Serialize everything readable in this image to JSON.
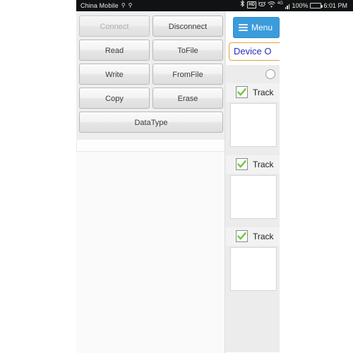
{
  "status_bar": {
    "carrier": "China Mobile",
    "sim_glyph_1": "⚲",
    "sim_glyph_2": "⚲",
    "bluetooth_icon": "bluetooth-icon",
    "hd_label": "HD",
    "alarm_icon": "alarm-icon",
    "wifi_icon": "wifi-icon",
    "network_type": "4G",
    "signal_icon": "signal-bars-icon",
    "battery_percent": "100%",
    "battery_icon": "battery-full-icon",
    "clock": "6:01 PM"
  },
  "device_app": {
    "buttons": [
      {
        "label": "Connect",
        "name": "connect-button",
        "disabled": true
      },
      {
        "label": "Disconnect",
        "name": "disconnect-button",
        "disabled": false
      },
      {
        "label": "Read",
        "name": "read-button",
        "disabled": false
      },
      {
        "label": "ToFile",
        "name": "tofile-button",
        "disabled": false
      },
      {
        "label": "Write",
        "name": "write-button",
        "disabled": false
      },
      {
        "label": "FromFile",
        "name": "fromfile-button",
        "disabled": false
      },
      {
        "label": "Copy",
        "name": "copy-button",
        "disabled": false
      },
      {
        "label": "Erase",
        "name": "erase-button",
        "disabled": false
      }
    ],
    "wide_button": {
      "label": "DataType",
      "name": "datatype-button"
    }
  },
  "web_panel": {
    "menu_button_label": "Menu",
    "menu_icon": "hamburger-menu-icon",
    "page_title": "Device O",
    "radio_icon": "radio-button-unselected-icon",
    "check_icon": "check-mark-icon",
    "tracks": [
      {
        "label": "Track",
        "checked": true,
        "value": ""
      },
      {
        "label": "Track",
        "checked": true,
        "value": ""
      },
      {
        "label": "Track",
        "checked": true,
        "value": ""
      }
    ]
  },
  "colors": {
    "status_bar_bg": "#111214",
    "menu_blue": "#3b9cdc",
    "title_border": "#d9a441",
    "title_text": "#2b2bbb",
    "check_green": "#7ac943",
    "battery_green": "#37d047"
  }
}
